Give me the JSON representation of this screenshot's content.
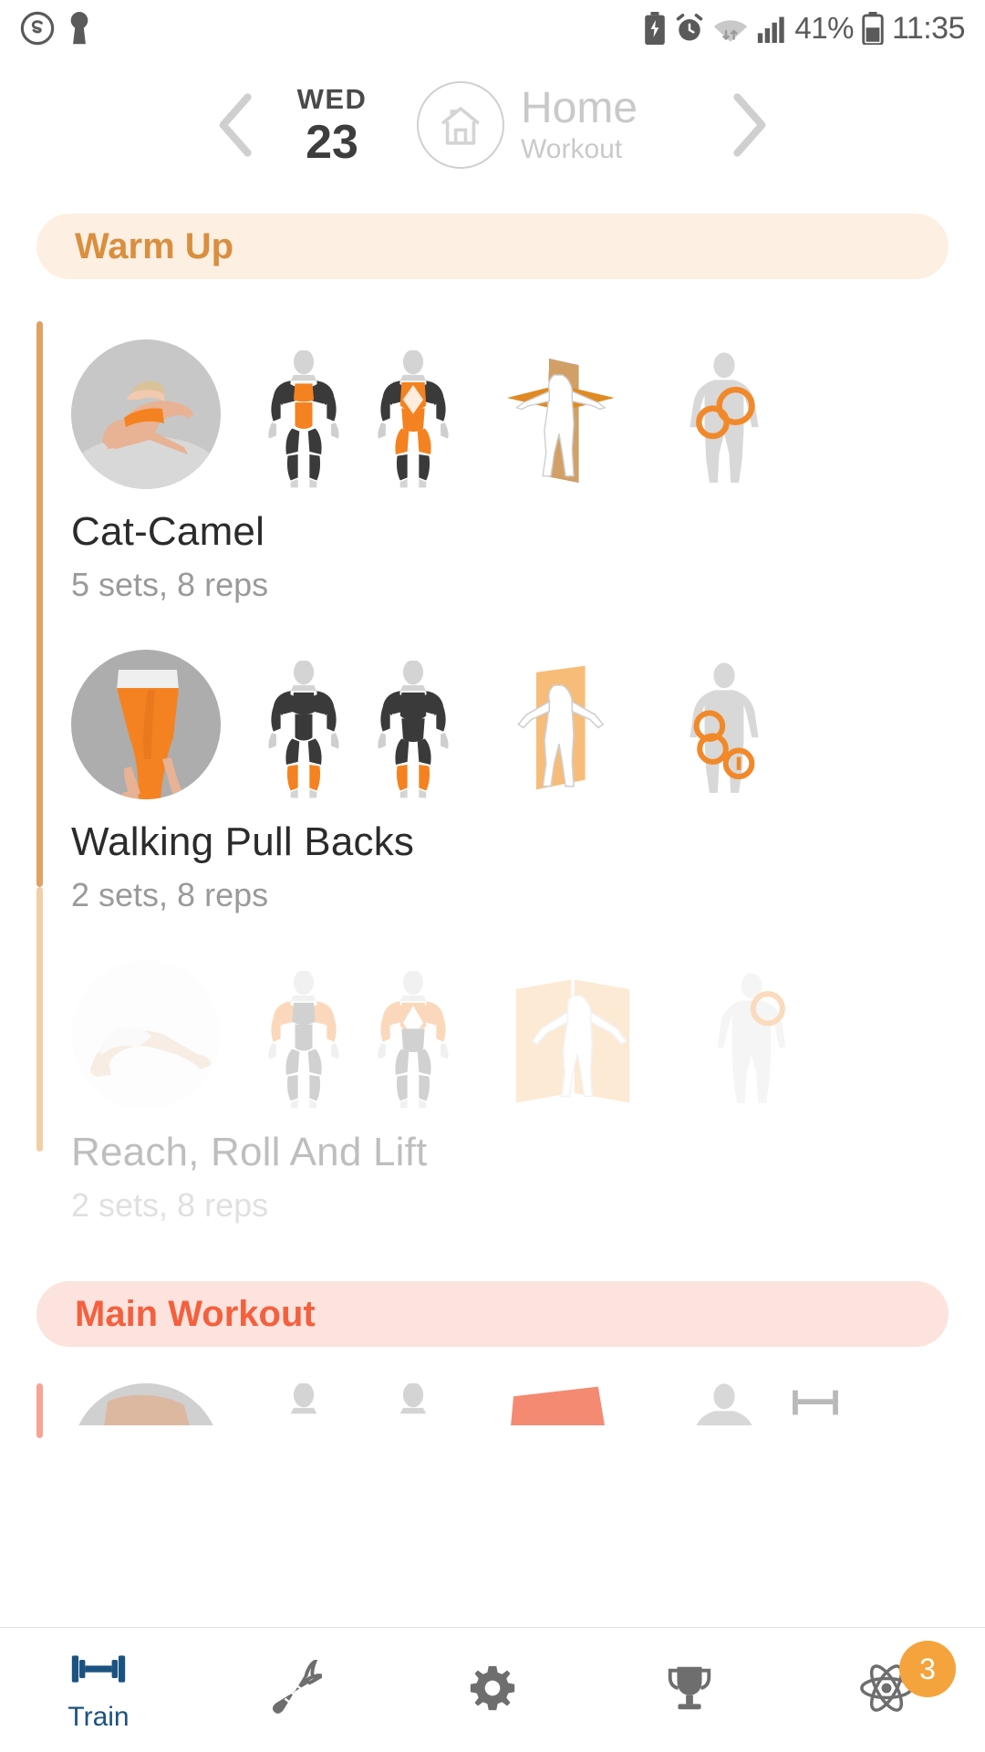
{
  "status_bar": {
    "left_icons": [
      "skype-circle-icon",
      "keyhole-icon"
    ],
    "right_icons": [
      "battery-saver-icon",
      "alarm-clock-icon",
      "wifi-icon",
      "signal-bars-icon",
      "battery-icon"
    ],
    "battery_percent": "41%",
    "time": "11:35"
  },
  "header": {
    "prev_icon": "chevron-left-icon",
    "next_icon": "chevron-right-icon",
    "day_of_week": "WED",
    "day_number": "23",
    "plan_icon": "home-icon",
    "plan_title": "Home",
    "plan_subtitle": "Workout"
  },
  "sections": [
    {
      "label": "Warm Up",
      "accent": "#d98f3f",
      "background": "#fdf0e3",
      "bar_color": "#e0a263",
      "exercises": [
        {
          "name": "Cat-Camel",
          "detail": "5 sets, 8 reps",
          "faded": false
        },
        {
          "name": "Walking Pull Backs",
          "detail": "2 sets, 8 reps",
          "faded": false
        },
        {
          "name": "Reach, Roll And Lift",
          "detail": "2 sets, 8 reps",
          "faded": true
        }
      ]
    },
    {
      "label": "Main Workout",
      "accent": "#f4603e",
      "background": "#fce3dd",
      "bar_color": "#f6a495",
      "exercises": []
    }
  ],
  "bottom_nav": {
    "items": [
      {
        "icon": "dumbbell-icon",
        "label": "Train",
        "active": true,
        "badge": ""
      },
      {
        "icon": "carrot-icon",
        "label": "",
        "active": false,
        "badge": ""
      },
      {
        "icon": "gear-icon",
        "label": "",
        "active": false,
        "badge": ""
      },
      {
        "icon": "trophy-icon",
        "label": "",
        "active": false,
        "badge": ""
      },
      {
        "icon": "atom-icon",
        "label": "",
        "active": false,
        "badge": "3"
      }
    ],
    "active_color": "#1c5280",
    "inactive_color": "#6e6e6e",
    "badge_color": "#f5a33c"
  },
  "colors": {
    "primary_orange": "#f39200",
    "muscle_secondary": "#3a3a3a",
    "text_dark": "#2b2b2b",
    "text_muted": "#9a9a9a"
  }
}
